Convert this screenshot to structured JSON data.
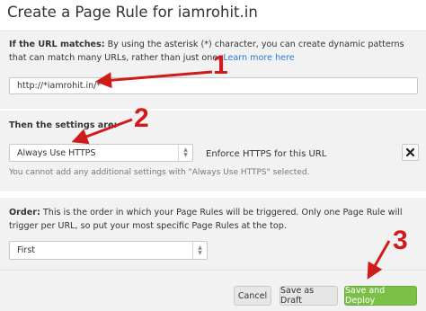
{
  "dialog": {
    "title": "Create a Page Rule for iamrohit.in"
  },
  "url_section": {
    "label": "If the URL matches:",
    "description": "By using the asterisk (*) character, you can create dynamic patterns that can match many URLs, rather than just one.",
    "learn_more": "Learn more here",
    "url_value": "http://*iamrohit.in/*"
  },
  "settings_section": {
    "label": "Then the settings are:",
    "setting_value": "Always Use HTTPS",
    "setting_detail": "Enforce HTTPS for this URL",
    "hint": "You cannot add any additional settings with \"Always Use HTTPS\" selected."
  },
  "order_section": {
    "label": "Order:",
    "description": "This is the order in which your Page Rules will be triggered. Only one Page Rule will trigger per URL, so put your most specific Page Rules at the top.",
    "order_value": "First"
  },
  "footer": {
    "cancel_label": "Cancel",
    "draft_label": "Save as Draft",
    "deploy_label": "Save and Deploy"
  },
  "annotations": {
    "step1": "1",
    "step2": "2",
    "step3": "3",
    "color": "#d11a1a"
  },
  "colors": {
    "link": "#2a7bd3",
    "primary_button": "#7cc04a",
    "section_bg": "#f2f2f2"
  }
}
